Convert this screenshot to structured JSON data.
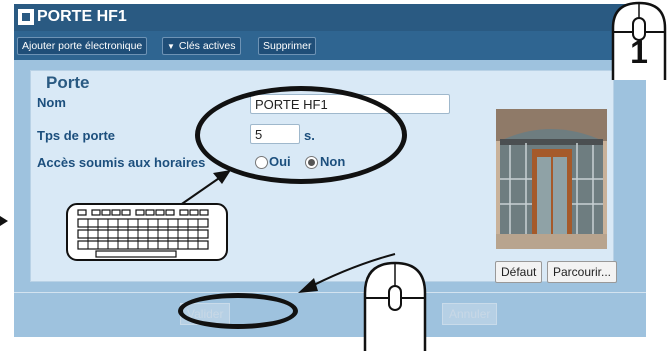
{
  "window": {
    "title": "PORTE HF1"
  },
  "toolbar": {
    "add_label": "Ajouter porte électronique",
    "keys_label": "Clés actives",
    "delete_label": "Supprimer"
  },
  "section": {
    "title": "Porte"
  },
  "form": {
    "name_label": "Nom",
    "name_value": "PORTE HF1",
    "time_label": "Tps de porte",
    "time_value": "5",
    "time_unit": "s.",
    "schedule_label": "Accès soumis aux horaires",
    "opt_yes": "Oui",
    "opt_no": "Non",
    "selected": "Non"
  },
  "image_buttons": {
    "default_label": "Défaut",
    "browse_label": "Parcourir..."
  },
  "footer": {
    "validate_label": "Valider",
    "cancel_label": "Annuler"
  },
  "callouts": {
    "step_number": "1"
  },
  "colors": {
    "titlebar": "#2a5a82",
    "panel": "#d9e9f6",
    "content_bg": "#9ec2de"
  }
}
